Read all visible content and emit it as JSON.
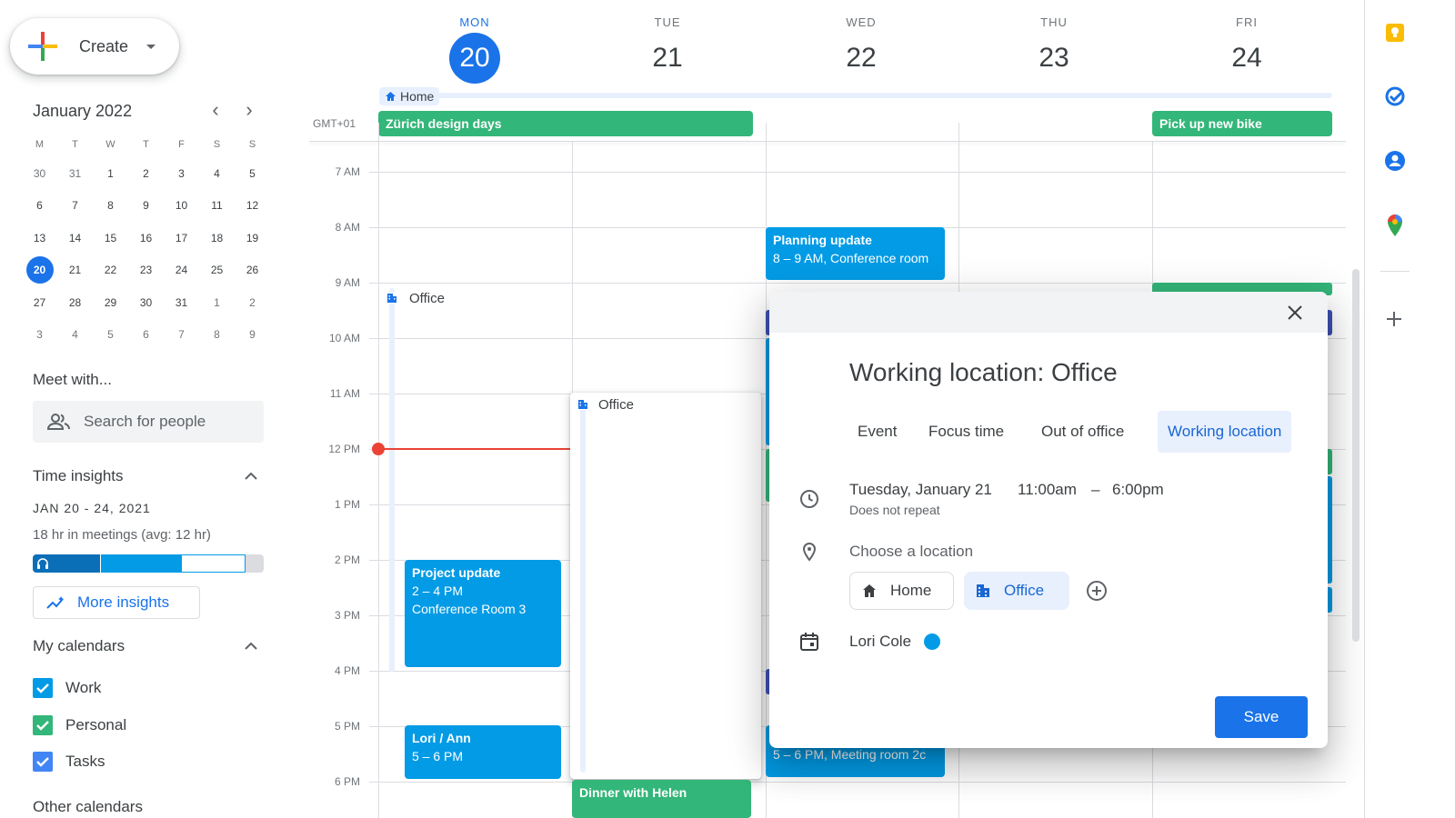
{
  "create": {
    "label": "Create"
  },
  "mini_calendar": {
    "title": "January 2022",
    "dow": [
      "M",
      "T",
      "W",
      "T",
      "F",
      "S",
      "S"
    ],
    "weeks": [
      [
        "30",
        "31",
        "1",
        "2",
        "3",
        "4",
        "5"
      ],
      [
        "6",
        "7",
        "8",
        "9",
        "10",
        "11",
        "12"
      ],
      [
        "13",
        "14",
        "15",
        "16",
        "17",
        "18",
        "19"
      ],
      [
        "20",
        "21",
        "22",
        "23",
        "24",
        "25",
        "26"
      ],
      [
        "27",
        "28",
        "29",
        "30",
        "31",
        "1",
        "2"
      ],
      [
        "3",
        "4",
        "5",
        "6",
        "7",
        "8",
        "9"
      ]
    ],
    "today": "20"
  },
  "meet": {
    "title": "Meet with...",
    "placeholder": "Search for people"
  },
  "time_insights": {
    "title": "Time insights",
    "range": "JAN 20 - 24, 2021",
    "meetings": "18 hr in meetings (avg: 12 hr)",
    "bar_segments": [
      0.29,
      0.35,
      0.28
    ],
    "bar_colors": [
      "#0b6fb8",
      "#039be5",
      "#ffffff"
    ],
    "more_label": "More insights"
  },
  "my_calendars": {
    "title": "My calendars",
    "items": [
      {
        "name": "Work",
        "color": "#039be5"
      },
      {
        "name": "Personal",
        "color": "#33b679"
      },
      {
        "name": "Tasks",
        "color": "#4285f4"
      }
    ],
    "other_title": "Other calendars"
  },
  "days": [
    {
      "dow": "MON",
      "num": "20",
      "today": true
    },
    {
      "dow": "TUE",
      "num": "21"
    },
    {
      "dow": "WED",
      "num": "22"
    },
    {
      "dow": "THU",
      "num": "23"
    },
    {
      "dow": "FRI",
      "num": "24"
    }
  ],
  "timezone": "GMT+01",
  "home_label": "Home",
  "allday_events": [
    {
      "title": "Zürich design days"
    },
    {
      "title": "Pick up new bike"
    }
  ],
  "hours": [
    "7 AM",
    "8 AM",
    "9 AM",
    "10 AM",
    "11 AM",
    "12 PM",
    "1 PM",
    "2 PM",
    "3 PM",
    "4 PM",
    "5 PM",
    "6 PM"
  ],
  "events": {
    "planning": {
      "title": "Planning update",
      "detail": "8 – 9 AM, Conference room"
    },
    "project": {
      "title": "Project update",
      "time": "2 – 4 PM",
      "room": "Conference Room 3"
    },
    "lori_ann": {
      "title": "Lori / Ann",
      "time": "5 – 6 PM"
    },
    "wed_meeting": {
      "detail": "5 – 6 PM, Meeting room 2c"
    },
    "dinner": {
      "title": "Dinner with Helen"
    },
    "office_mon": {
      "label": "Office"
    },
    "office_tue": {
      "label": "Office"
    }
  },
  "dialog": {
    "title": "Working location: Office",
    "tabs": [
      "Event",
      "Focus time",
      "Out of office",
      "Working location"
    ],
    "date": "Tuesday, January 21",
    "start": "11:00am",
    "dash": "–",
    "end": "6:00pm",
    "repeat": "Does not repeat",
    "choose_location": "Choose a location",
    "home": "Home",
    "office": "Office",
    "owner": "Lori Cole",
    "owner_color": "#039be5",
    "save": "Save"
  },
  "colors": {
    "accent": "#1a73e8",
    "event_blue": "#039be5",
    "event_green": "#33b679",
    "event_purple": "#3f51b5",
    "now_line": "#ea4335"
  }
}
